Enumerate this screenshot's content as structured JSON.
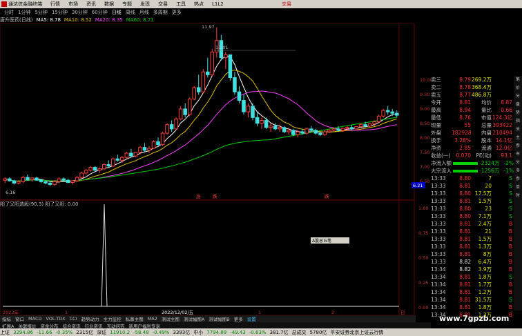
{
  "app": {
    "name": "通达信金融终端",
    "menu": [
      "行情",
      "市场",
      "资讯",
      "数据",
      "专题",
      "发现",
      "交易",
      "工具",
      "热点",
      "L1L2"
    ],
    "right_label": "交易",
    "right2": "□"
  },
  "period_tabs": [
    "分时",
    "1分钟",
    "5分钟",
    "15分钟",
    "30分钟",
    "60分钟",
    "日线",
    "周线",
    "月线",
    "多周期",
    "更多"
  ],
  "active_period": "日线",
  "legend": {
    "title": "唐升医药(日线)",
    "items": [
      {
        "label": "MA5: 8.78",
        "color": "#ffffff"
      },
      {
        "label": "MA10: 8.52",
        "color": "#e0c000"
      },
      {
        "label": "MA20: 8.35",
        "color": "#ff40ff"
      },
      {
        "label": "MA60: 8.71",
        "color": "#00d000"
      }
    ]
  },
  "chart_labels": {
    "high": "11.97",
    "mid": "11.01",
    "low": "6.16",
    "right_price": "6.21",
    "right_axis": [
      "10.00",
      "9.50",
      "9.00",
      "8.50",
      "8.00",
      "7.50",
      "7.00",
      "6.50"
    ],
    "sub_axis": [
      "1.00",
      "0.75",
      "0.50",
      "0.25",
      "0.00"
    ],
    "date_axis": [
      "2022年",
      "1",
      "2022/12/02/五",
      "1",
      "2",
      "日"
    ],
    "markers": [
      "涨",
      "跌",
      "跌"
    ]
  },
  "sub_legend": "阳了又阳选股(90,3)  阳了又阳: 0.00",
  "popup": "A股总五笔",
  "quote": {
    "rows": [
      {
        "label": "卖三",
        "price": "8.79",
        "vol": "269.2万"
      },
      {
        "label": "卖二",
        "price": "8.78",
        "vol": "368.4万"
      },
      {
        "label": "卖五",
        "price": "8.77",
        "vol": "486.8万"
      }
    ],
    "stats": [
      {
        "k1": "今开",
        "v1": "8.81",
        "k2": "均价",
        "v2": "8.87"
      },
      {
        "k1": "最高",
        "v1": "8.94",
        "k2": "量比",
        "v2": "0.66"
      },
      {
        "k1": "最低",
        "v1": "8.76",
        "k2": "市值",
        "v2": "124.3亿"
      },
      {
        "k1": "现量",
        "v1": "55",
        "k2": "总量",
        "v2": "393422"
      },
      {
        "k1": "外盘",
        "v1": "182928",
        "k2": "内盘",
        "v2": "210494"
      },
      {
        "k1": "换手",
        "v1": "3.28%",
        "k2": "股本",
        "v2": "14.1亿"
      },
      {
        "k1": "净资",
        "v1": "2.85",
        "k2": "流通",
        "v2": "12.0亿"
      },
      {
        "k1": "收益(一)",
        "v1": "0.070",
        "k2": "PE(动)",
        "v2": "93.1"
      }
    ],
    "flows": [
      {
        "label": "净流入额",
        "value": "-2324万",
        "pct": "-2%"
      },
      {
        "label": "大宗流入",
        "value": "-1256万",
        "pct": "-1%"
      }
    ],
    "ticks": [
      {
        "t": "13:33",
        "p": "8.80",
        "v": "7",
        "d": "S"
      },
      {
        "t": "13:33",
        "p": "8.81",
        "v": "20",
        "d": "S"
      },
      {
        "t": "13:33",
        "p": "8.80",
        "v": "17.5万",
        "d": "S"
      },
      {
        "t": "13:33",
        "p": "8.81",
        "v": "1.5万",
        "d": "S"
      },
      {
        "t": "13:33",
        "p": "8.80",
        "v": "23",
        "d": "S"
      },
      {
        "t": "13:33",
        "p": "8.80",
        "v": "7.1万",
        "d": "S"
      },
      {
        "t": "13:33",
        "p": "8.81",
        "v": "2.4万",
        "d": "B"
      },
      {
        "t": "13:33",
        "p": "8.81",
        "v": "21",
        "d": "B"
      },
      {
        "t": "13:33",
        "p": "8.81",
        "v": "1.5万",
        "d": "B"
      },
      {
        "t": "13:33",
        "p": "8.81",
        "v": "1.3万",
        "d": "B"
      },
      {
        "t": "13:33",
        "p": "8.81",
        "v": "8万",
        "d": "B"
      },
      {
        "t": "13:33",
        "p": "8.82",
        "v": "6.4万",
        "d": "B"
      },
      {
        "t": "13:34",
        "p": "8.82",
        "v": "3.9万",
        "d": "B"
      },
      {
        "t": "13:34",
        "p": "8.81",
        "v": "1.8万",
        "d": "S"
      },
      {
        "t": "13:34",
        "p": "8.81",
        "v": "1.7万",
        "d": "B"
      },
      {
        "t": "13:34",
        "p": "8.81",
        "v": "1.2万",
        "d": "B"
      },
      {
        "t": "13:34",
        "p": "8.81",
        "v": "31.5万",
        "d": "S"
      },
      {
        "t": "13:34",
        "p": "8.81",
        "v": "1.8万",
        "d": "B"
      },
      {
        "t": "13:34",
        "p": "8.81",
        "v": "1.3万",
        "d": "B"
      }
    ]
  },
  "indicator_tabs": [
    "指标",
    "窗口",
    "MACD",
    "VOL-TDX",
    "CCI",
    "趋势动力",
    "主力监控",
    "私募主图",
    "MA2",
    "测试主图",
    "测试幅图A",
    "测试幅图B",
    "更多",
    "设置"
  ],
  "bottom_tabs": [
    "扩展A",
    "关联报价",
    "资金分布",
    "综合资讯",
    "行业资讯",
    "互动问答",
    "新用户福利专享"
  ],
  "status": [
    {
      "name": "上证",
      "value": "3294.86",
      "chg": "-11.66",
      "pct": "-0.35%",
      "amt": "2315亿"
    },
    {
      "name": "深证",
      "value": "11910.2",
      "chg": "-58.48",
      "pct": "-0.49%",
      "amt": "3393亿"
    },
    {
      "name": "中小",
      "value": "7794.89",
      "chg": "-49.43",
      "pct": "-0.63%",
      "amt": "381.7亿"
    }
  ],
  "status_extra": [
    "总成交",
    "5780亿",
    "平安证券北京上证云行情"
  ],
  "watermark": "www.7gpzb.com",
  "sidebar": [
    "笔",
    "价",
    "分",
    "盘",
    "势",
    "指",
    "关",
    "主",
    "参",
    "市",
    "分",
    "多",
    "参",
    "单",
    "时"
  ],
  "chart_data": {
    "type": "candlestick",
    "ma_labels": [
      "MA5",
      "MA10",
      "MA20",
      "MA60"
    ],
    "price_range": [
      6.16,
      11.97
    ],
    "candles": [
      [
        6.6,
        6.7,
        6.5,
        6.65
      ],
      [
        6.65,
        6.7,
        6.55,
        6.58
      ],
      [
        6.58,
        6.62,
        6.45,
        6.5
      ],
      [
        6.5,
        6.6,
        6.45,
        6.55
      ],
      [
        6.55,
        6.75,
        6.5,
        6.7
      ],
      [
        6.7,
        6.8,
        6.6,
        6.62
      ],
      [
        6.62,
        6.7,
        6.55,
        6.68
      ],
      [
        6.68,
        6.72,
        6.58,
        6.6
      ],
      [
        6.6,
        6.65,
        6.5,
        6.55
      ],
      [
        6.55,
        6.6,
        6.45,
        6.5
      ],
      [
        6.5,
        6.58,
        6.4,
        6.45
      ],
      [
        6.45,
        6.6,
        6.4,
        6.55
      ],
      [
        6.55,
        6.7,
        6.5,
        6.65
      ],
      [
        6.65,
        6.7,
        6.55,
        6.6
      ],
      [
        6.6,
        6.65,
        6.5,
        6.52
      ],
      [
        6.52,
        6.6,
        6.45,
        6.58
      ],
      [
        6.58,
        6.75,
        6.55,
        6.7
      ],
      [
        6.7,
        6.9,
        6.65,
        6.85
      ],
      [
        6.85,
        7.0,
        6.8,
        6.95
      ],
      [
        6.95,
        7.1,
        6.9,
        7.05
      ],
      [
        7.05,
        7.1,
        6.9,
        6.95
      ],
      [
        6.95,
        7.05,
        6.85,
        7.0
      ],
      [
        7.0,
        7.2,
        6.95,
        7.15
      ],
      [
        7.15,
        7.3,
        7.05,
        7.1
      ],
      [
        7.1,
        7.4,
        7.05,
        7.35
      ],
      [
        7.35,
        7.5,
        7.25,
        7.3
      ],
      [
        7.3,
        7.45,
        7.2,
        7.4
      ],
      [
        7.4,
        7.6,
        7.35,
        7.55
      ],
      [
        7.55,
        7.7,
        7.4,
        7.45
      ],
      [
        7.45,
        7.6,
        7.4,
        7.58
      ],
      [
        7.58,
        7.8,
        7.5,
        7.75
      ],
      [
        7.75,
        7.9,
        7.6,
        7.65
      ],
      [
        7.65,
        7.8,
        7.55,
        7.72
      ],
      [
        7.72,
        8.0,
        7.7,
        7.95
      ],
      [
        7.95,
        8.1,
        7.8,
        7.85
      ],
      [
        7.85,
        8.3,
        7.8,
        8.25
      ],
      [
        8.25,
        8.6,
        8.2,
        8.55
      ],
      [
        8.55,
        8.7,
        8.3,
        8.4
      ],
      [
        8.4,
        8.8,
        8.35,
        8.75
      ],
      [
        8.75,
        9.2,
        8.7,
        9.1
      ],
      [
        9.1,
        9.3,
        8.8,
        8.9
      ],
      [
        8.9,
        9.5,
        8.85,
        9.45
      ],
      [
        9.45,
        9.9,
        9.4,
        9.85
      ],
      [
        9.85,
        10.3,
        9.6,
        9.7
      ],
      [
        9.7,
        10.5,
        9.65,
        10.4
      ],
      [
        10.4,
        10.9,
        10.2,
        10.3
      ],
      [
        10.3,
        11.2,
        10.25,
        11.1
      ],
      [
        11.1,
        11.97,
        10.9,
        11.5
      ],
      [
        11.5,
        11.7,
        10.8,
        10.9
      ],
      [
        10.9,
        11.1,
        10.5,
        11.0
      ],
      [
        11.0,
        11.01,
        10.1,
        10.2
      ],
      [
        10.2,
        10.4,
        9.6,
        9.7
      ],
      [
        9.7,
        9.9,
        9.3,
        9.4
      ],
      [
        9.4,
        9.6,
        8.9,
        9.0
      ],
      [
        9.0,
        9.3,
        8.8,
        9.2
      ],
      [
        9.2,
        9.3,
        8.7,
        8.8
      ],
      [
        8.8,
        9.0,
        8.5,
        8.6
      ],
      [
        8.6,
        8.8,
        8.4,
        8.7
      ],
      [
        8.7,
        8.8,
        8.4,
        8.45
      ],
      [
        8.45,
        8.6,
        8.3,
        8.5
      ],
      [
        8.5,
        8.6,
        8.35,
        8.4
      ],
      [
        8.4,
        8.55,
        8.3,
        8.45
      ],
      [
        8.45,
        8.5,
        8.25,
        8.3
      ],
      [
        8.3,
        8.45,
        8.2,
        8.35
      ],
      [
        8.35,
        8.4,
        8.15,
        8.2
      ],
      [
        8.2,
        8.35,
        8.1,
        8.3
      ],
      [
        8.3,
        8.4,
        8.2,
        8.25
      ],
      [
        8.25,
        8.45,
        8.2,
        8.4
      ],
      [
        8.4,
        8.5,
        8.3,
        8.35
      ],
      [
        8.35,
        8.4,
        8.2,
        8.25
      ],
      [
        8.25,
        8.3,
        8.15,
        8.2
      ],
      [
        8.2,
        8.35,
        8.15,
        8.3
      ],
      [
        8.3,
        8.4,
        8.25,
        8.35
      ],
      [
        8.35,
        8.45,
        8.3,
        8.4
      ],
      [
        8.4,
        8.5,
        8.3,
        8.35
      ],
      [
        8.35,
        8.45,
        8.3,
        8.42
      ],
      [
        8.42,
        8.5,
        8.35,
        8.45
      ],
      [
        8.45,
        8.55,
        8.35,
        8.4
      ],
      [
        8.4,
        8.5,
        8.35,
        8.48
      ],
      [
        8.48,
        8.6,
        8.45,
        8.55
      ],
      [
        8.55,
        8.65,
        8.45,
        8.5
      ],
      [
        8.5,
        8.6,
        8.45,
        8.58
      ],
      [
        8.58,
        8.7,
        8.5,
        8.65
      ],
      [
        8.65,
        8.9,
        8.6,
        8.85
      ],
      [
        8.85,
        9.1,
        8.8,
        9.05
      ],
      [
        9.05,
        9.2,
        8.9,
        9.0
      ],
      [
        9.0,
        9.1,
        8.85,
        8.95
      ],
      [
        8.95,
        9.05,
        8.8,
        8.88
      ]
    ],
    "indicator": {
      "name": "阳了又阳",
      "value": 0.0,
      "spike_index": 20,
      "spike_value": 1.0
    }
  }
}
